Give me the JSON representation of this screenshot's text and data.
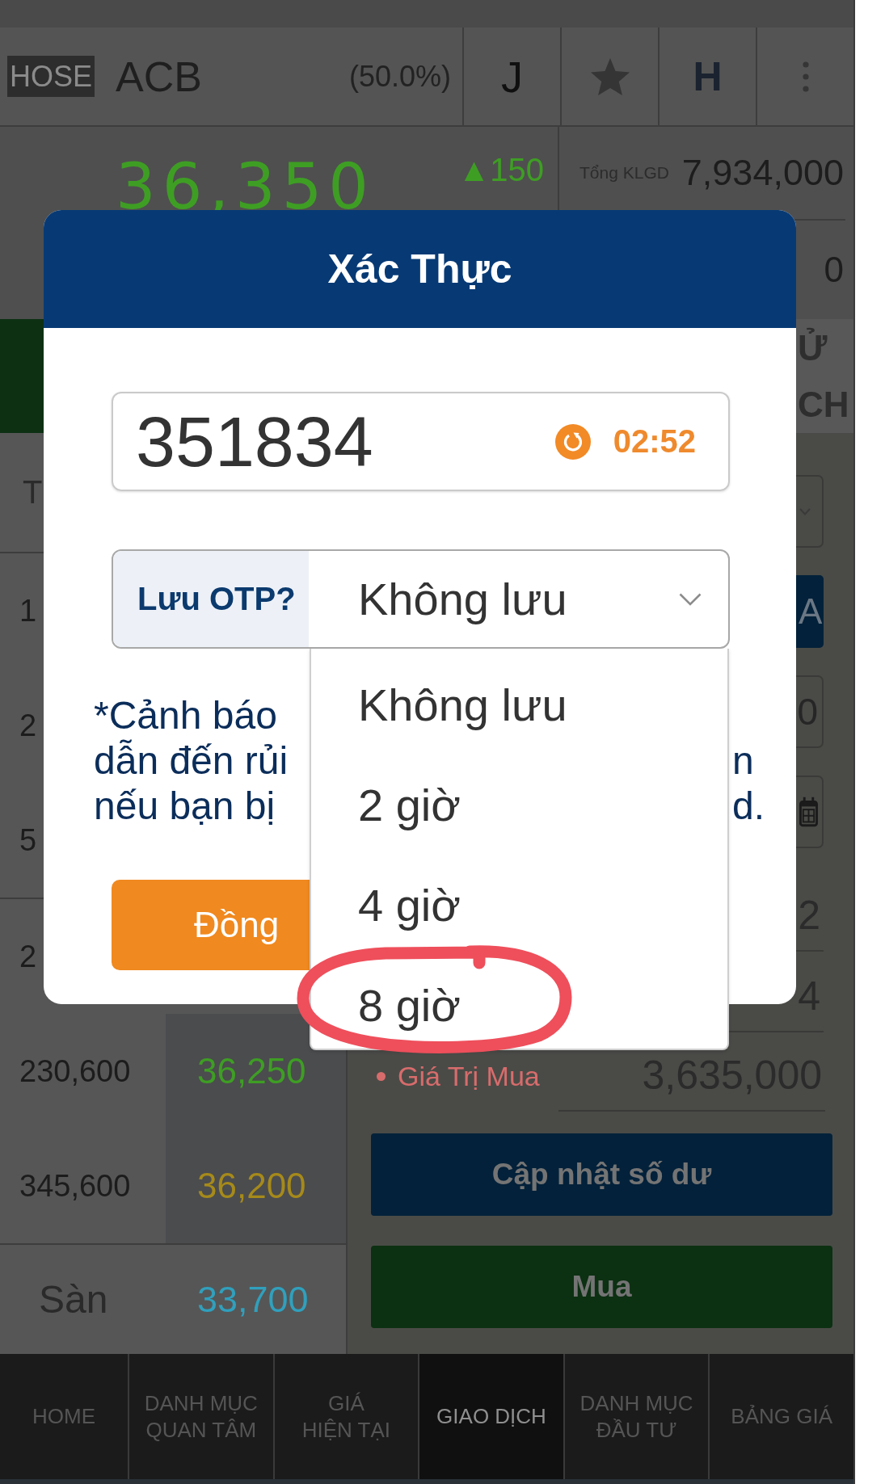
{
  "header": {
    "exchange": "HOSE",
    "symbol": "ACB",
    "ratio": "(50.0%)",
    "actions": [
      {
        "kind": "text",
        "label": "J"
      },
      {
        "kind": "star"
      },
      {
        "kind": "bold",
        "label": "H"
      },
      {
        "kind": "more"
      }
    ]
  },
  "quote": {
    "price": "36,350",
    "change": "▲150",
    "volume_label": "Tổng KLGD",
    "volume": "7,934,000",
    "extra_value": "0"
  },
  "tabs": [
    {
      "selected": true
    },
    {
      "label": [
        "Ử",
        "CH"
      ],
      "selected": false
    }
  ],
  "order_book": {
    "header": "T",
    "groups": [
      [
        {
          "volume": "1"
        },
        {
          "volume": "2"
        },
        {
          "volume": "5"
        }
      ],
      [
        {
          "volume": "2"
        },
        {
          "volume": "230,600",
          "price": "36,250",
          "color": "#3e9e24"
        },
        {
          "volume": "345,600",
          "price": "36,200",
          "color": "#a68a1a"
        }
      ]
    ],
    "floor": {
      "label": "Sàn",
      "price": "33,700",
      "color": "#30a0bd"
    }
  },
  "order_form": {
    "fields": [
      {
        "kind": "select"
      },
      {
        "kind": "button",
        "label": "A"
      },
      {
        "kind": "input",
        "value": "0"
      },
      {
        "kind": "date"
      },
      {
        "kind": "value",
        "value": "2"
      },
      {
        "kind": "value",
        "value": "4"
      },
      {
        "kind": "summary",
        "label": "Giá Trị Mua",
        "value": "3,635,000"
      }
    ],
    "buttons": [
      {
        "kind": "update",
        "label": "Cập nhật số dư"
      },
      {
        "kind": "buy",
        "label": "Mua"
      }
    ]
  },
  "bottom_nav": [
    {
      "label": [
        "HOME"
      ],
      "selected": false
    },
    {
      "label": [
        "DANH MỤC",
        "QUAN TÂM"
      ],
      "selected": false
    },
    {
      "label": [
        "GIÁ",
        "HIỆN TẠI"
      ],
      "selected": false
    },
    {
      "label": [
        "GIAO DỊCH"
      ],
      "selected": true
    },
    {
      "label": [
        "DANH MỤC",
        "ĐẦU TƯ"
      ],
      "selected": false
    },
    {
      "label": [
        "BẢNG GIÁ"
      ],
      "selected": false
    }
  ],
  "dialog": {
    "title": "Xác Thực",
    "otp": "351834",
    "timer": "02:52",
    "save_label": "Lưu OTP?",
    "save_value": "Không lưu",
    "expanded": true,
    "options": [
      {
        "label": "Không lưu",
        "circled": false
      },
      {
        "label": "2 giờ",
        "circled": false
      },
      {
        "label": "4 giờ",
        "circled": false
      },
      {
        "label": "8 giờ",
        "circled": true
      }
    ],
    "warning": [
      {
        "left": "*Cảnh báo"
      },
      {
        "left": "dẫn đến rủi",
        "right": "n"
      },
      {
        "left": "nếu bạn bị",
        "right": "d."
      }
    ],
    "confirm": "Đồng"
  }
}
